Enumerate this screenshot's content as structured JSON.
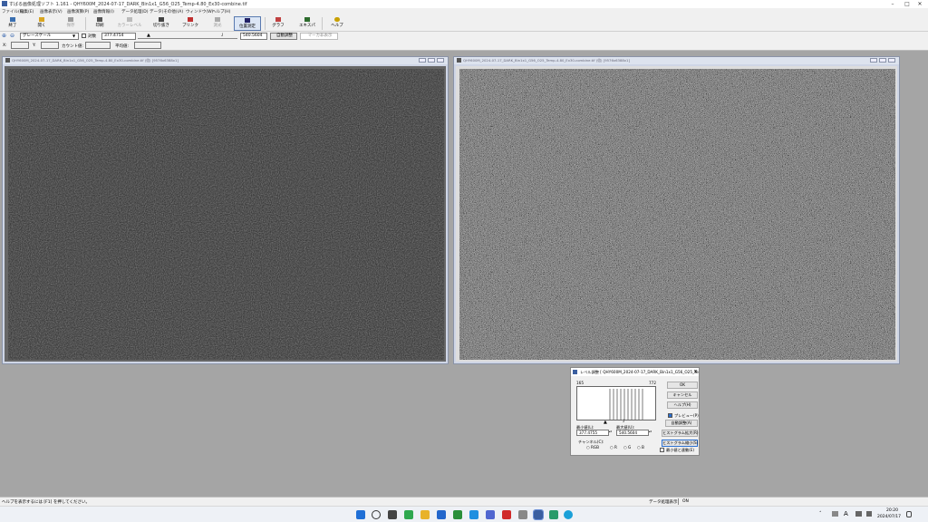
{
  "window": {
    "title": "すばる画像処理ソフト 1.161 - QHY600M_2024-07-17_DARK_Bin1x1_G56_O25_Temp-4.80_Ex30-combine.tif",
    "controls": [
      "–",
      "□",
      "✕"
    ]
  },
  "menu": [
    "ファイル(F)",
    "編集(E)",
    "画像表示(V)",
    "画像演算(P)",
    "画像情報(I)",
    "データ処理(D)",
    "データ(その他)(A)",
    "ウィンドウ(W)",
    "ヘルプ(H)"
  ],
  "toolbar": [
    {
      "label": "終了",
      "icon": "exit-icon",
      "color": "#3a6fb0",
      "enabled": true
    },
    {
      "label": "開く",
      "icon": "open-icon",
      "color": "#d9a520",
      "enabled": true
    },
    {
      "label": "保存",
      "icon": "save-icon",
      "color": "#888888",
      "enabled": false
    },
    {
      "label": "印刷",
      "icon": "print-icon",
      "color": "#555555",
      "enabled": true
    },
    {
      "label": "カラーレベル",
      "icon": "color-level-icon",
      "color": "#aaaaaa",
      "enabled": false
    },
    {
      "label": "切り抜き",
      "icon": "crop-icon",
      "color": "#444444",
      "enabled": true
    },
    {
      "label": "ブリンク",
      "icon": "blink-icon",
      "color": "#c03030",
      "enabled": true
    },
    {
      "label": "測光",
      "icon": "photometry-icon",
      "color": "#999999",
      "enabled": false
    },
    {
      "label": "位置測定",
      "icon": "position-icon",
      "color": "#222266",
      "enabled": true
    },
    {
      "label": "グラフ",
      "icon": "graph-icon",
      "color": "#c04040",
      "enabled": true
    },
    {
      "label": "エキスパ",
      "icon": "expert-icon",
      "color": "#2d6b2d",
      "enabled": true
    },
    {
      "label": "ヘルプ",
      "icon": "help-icon",
      "color": "#c8a000",
      "enabled": true
    }
  ],
  "options": {
    "colormap": "グレースケール",
    "log_label": "対数",
    "min_value": "377.4754",
    "max_value": "540.5604",
    "auto_adjust": "自動調整",
    "marker_hide": "マーカ非表示"
  },
  "status": {
    "x_label": "X:",
    "y_label": "Y:",
    "count_label": "カウント値:",
    "mean_label": "平均値:"
  },
  "child_windows": [
    {
      "title": "QHY600M_2024-07-17_DARK_Bin1x1_G56_O25_Temp-4.80_Ex30-combine.tif (倍) [9576x6388x1]"
    },
    {
      "title": "QHY600M_2024-07-17_DARK_Bin1x1_G56_O25_Temp-4.80_Ex30-combine.tif (倍) [9576x6388x1]"
    }
  ],
  "dialog": {
    "title": "レベル調整 [ QHY600M_2024-07-17_DARK_Bin1x1_G56_O25_Temp-...",
    "hist_min": "165",
    "hist_max": "772",
    "min_label": "最小値(L):",
    "max_label": "最大値(U):",
    "min_value": "377.4755",
    "max_value": "540.5604",
    "channel_label": "チャンネル(C):",
    "channels": [
      "RGB",
      "R",
      "G",
      "B"
    ],
    "buttons": {
      "ok": "OK",
      "cancel": "キャンセル",
      "help": "ヘルプ(H)",
      "auto": "自動調整(A)",
      "hist_expand": "ヒストグラム拡大(R)",
      "hist_shrink": "ヒストグラム縮小(S)"
    },
    "preview_label": "プレビュー(P)",
    "minmax_link_label": "最小値と連動(E)",
    "close": "✕"
  },
  "bottom_status": {
    "help_hint": "ヘルプを表示するには [F1] を押してください。",
    "data_display": "データ処理表示",
    "state": "ON"
  },
  "taskbar": {
    "time": "20:20",
    "date": "2024/07/17",
    "lang": "A"
  }
}
